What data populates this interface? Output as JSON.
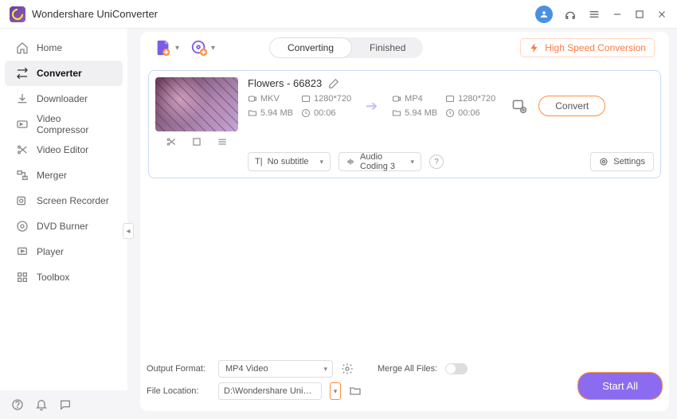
{
  "app": {
    "title": "Wondershare UniConverter"
  },
  "sidebar": {
    "items": [
      {
        "label": "Home"
      },
      {
        "label": "Converter"
      },
      {
        "label": "Downloader"
      },
      {
        "label": "Video Compressor"
      },
      {
        "label": "Video Editor"
      },
      {
        "label": "Merger"
      },
      {
        "label": "Screen Recorder"
      },
      {
        "label": "DVD Burner"
      },
      {
        "label": "Player"
      },
      {
        "label": "Toolbox"
      }
    ]
  },
  "toolbar": {
    "tabs": {
      "converting": "Converting",
      "finished": "Finished"
    },
    "high_speed": "High Speed Conversion"
  },
  "file": {
    "name": "Flowers - 66823",
    "src": {
      "format": "MKV",
      "resolution": "1280*720",
      "size": "5.94 MB",
      "duration": "00:06"
    },
    "dst": {
      "format": "MP4",
      "resolution": "1280*720",
      "size": "5.94 MB",
      "duration": "00:06"
    },
    "convert_label": "Convert",
    "subtitle": "No subtitle",
    "audio": "Audio Coding 3",
    "settings_label": "Settings"
  },
  "bottom": {
    "output_format_label": "Output Format:",
    "output_format_value": "MP4 Video",
    "file_location_label": "File Location:",
    "file_location_value": "D:\\Wondershare UniConverter",
    "merge_label": "Merge All Files:",
    "start_all": "Start All"
  }
}
